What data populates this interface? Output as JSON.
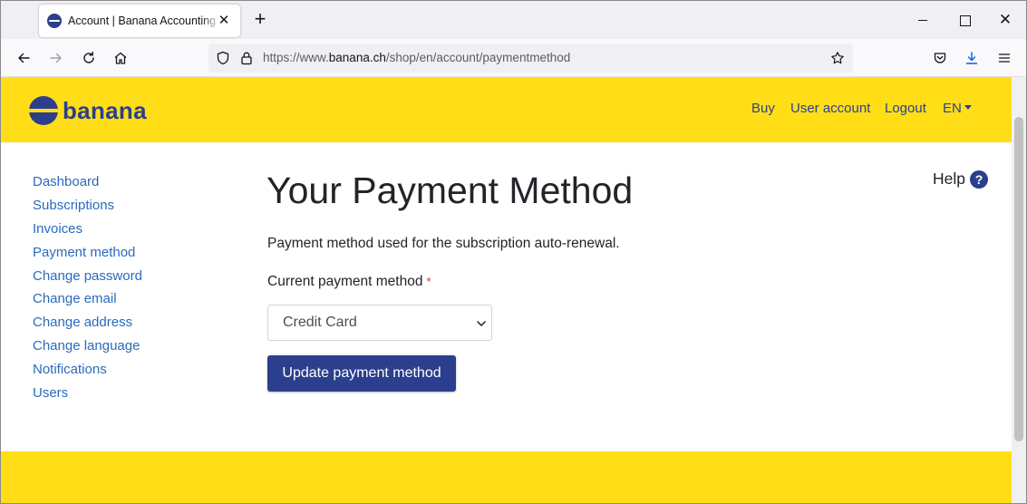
{
  "browser": {
    "tab_title": "Account | Banana Accounting Software",
    "url_prefix": "https://www.",
    "url_domain": "banana.ch",
    "url_path": "/shop/en/account/paymentmethod",
    "new_tab_glyph": "+",
    "close_glyph": "✕"
  },
  "site": {
    "logo_text": "banana",
    "brand_color": "#ffde18",
    "accent_color": "#2b3f8e",
    "top_nav": [
      "Buy",
      "User account",
      "Logout"
    ],
    "language": "EN",
    "sidebar": [
      "Dashboard",
      "Subscriptions",
      "Invoices",
      "Payment method",
      "Change password",
      "Change email",
      "Change address",
      "Change language",
      "Notifications",
      "Users"
    ],
    "help": {
      "label": "Help",
      "icon_glyph": "?"
    },
    "page_title": "Your Payment Method",
    "description": "Payment method used for the subscription auto-renewal.",
    "field_label": "Current payment method",
    "required_marker": "*",
    "selected_method": "Credit Card",
    "submit_label": "Update payment method"
  }
}
